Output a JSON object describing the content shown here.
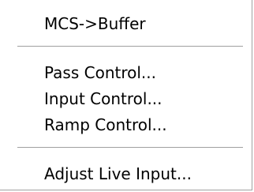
{
  "menu": {
    "items": [
      {
        "label": "MCS->Buffer"
      },
      {
        "label": "Pass Control..."
      },
      {
        "label": "Input Control..."
      },
      {
        "label": "Ramp Control..."
      },
      {
        "label": "Adjust Live Input..."
      }
    ],
    "colors": {
      "background": "#ffffff",
      "text": "#000000",
      "separator": "#a0a0a0"
    }
  }
}
